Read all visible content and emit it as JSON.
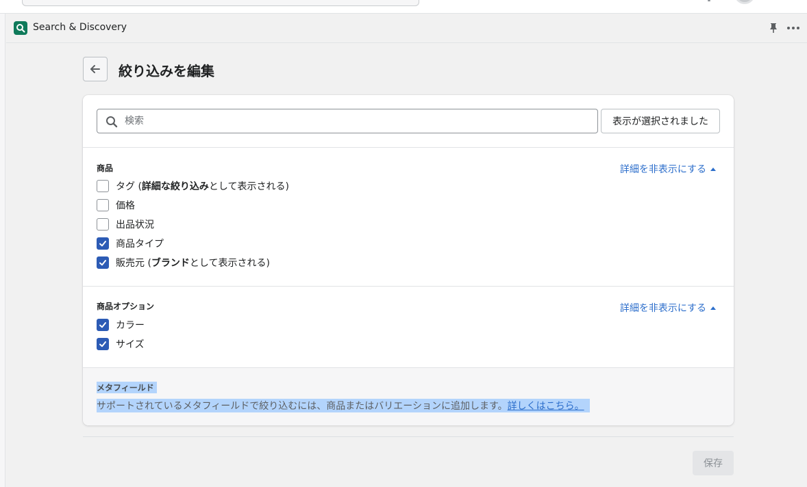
{
  "app": {
    "title": "Search & Discovery"
  },
  "page": {
    "title": "絞り込みを編集"
  },
  "search": {
    "placeholder": "検索",
    "value": "",
    "selected_button": "表示が選択されました"
  },
  "sections": {
    "product": {
      "heading": "商品",
      "toggle": "詳細を非表示にする",
      "options": [
        {
          "pre": "タグ (",
          "bold": "詳細な絞り込み",
          "post": "として表示される)",
          "checked": false
        },
        {
          "pre": "価格",
          "bold": "",
          "post": "",
          "checked": false
        },
        {
          "pre": "出品状況",
          "bold": "",
          "post": "",
          "checked": false
        },
        {
          "pre": "商品タイプ",
          "bold": "",
          "post": "",
          "checked": true
        },
        {
          "pre": "販売元 (",
          "bold": "ブランド",
          "post": "として表示される)",
          "checked": true
        }
      ]
    },
    "variant": {
      "heading": "商品オプション",
      "toggle": "詳細を非表示にする",
      "options": [
        {
          "pre": "カラー",
          "bold": "",
          "post": "",
          "checked": true
        },
        {
          "pre": "サイズ",
          "bold": "",
          "post": "",
          "checked": true
        }
      ]
    },
    "metafields": {
      "heading": "メタフィールド",
      "text": "サポートされているメタフィールドで絞り込むには、商品またはバリエーションに追加します。",
      "link": "詳しくはこちら。"
    }
  },
  "footer": {
    "save_label": "保存"
  },
  "colors": {
    "accent": "#2c5bb5",
    "link": "#2c6ecb",
    "app_icon": "#0f7a5a",
    "selection": "#b3d4fc"
  }
}
